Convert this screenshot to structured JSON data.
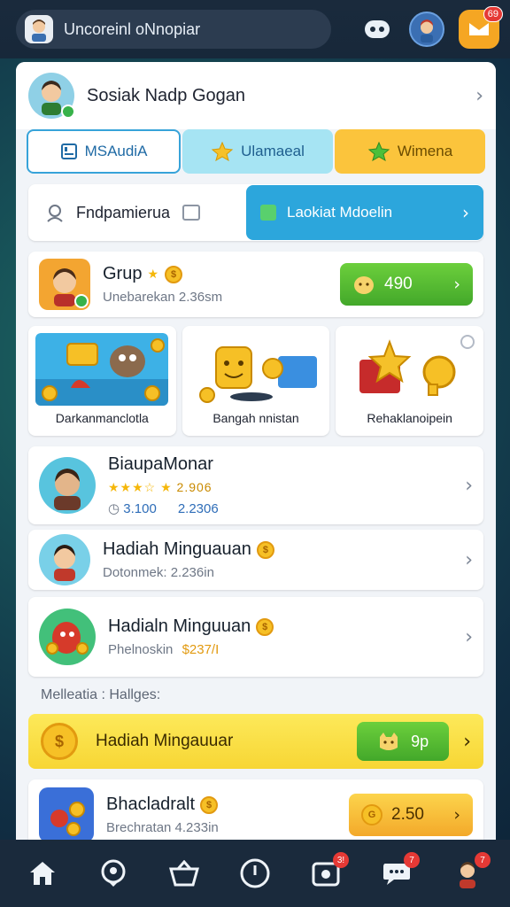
{
  "topbar": {
    "search_text": "Uncoreinl oNnopiar",
    "notif_badge": "69"
  },
  "profile": {
    "name": "Sosiak Nadp Gogan"
  },
  "tabs": [
    {
      "label": "MSAudiA"
    },
    {
      "label": "Ulamaeal"
    },
    {
      "label": "Wimena"
    }
  ],
  "filter": {
    "label": "Fndpamierua",
    "button_label": "Laokiat Mdoelin"
  },
  "group_card": {
    "title": "Grup",
    "subtitle": "Unebarekan 2.36sm",
    "button_value": "490"
  },
  "tiles": [
    {
      "label": "Darkanmanclotla"
    },
    {
      "label": "Bangah nnistan"
    },
    {
      "label": "Rehaklanoipein"
    }
  ],
  "list": [
    {
      "title": "BiaupaMonar",
      "rating": "2.906",
      "meta_a": "3.100",
      "meta_b": "2.2306"
    },
    {
      "title": "Hadiah Minguauan",
      "subtitle": "Dotonmek: 2.236in"
    },
    {
      "title": "Hadialn Minguuan",
      "subtitle_label": "Phelnoskin",
      "subtitle_value": "$237/I"
    }
  ],
  "section_label": "Melleatia : Hallges:",
  "yellow_bar": {
    "label": "Hadiah Mingauuar",
    "button_value": "9p"
  },
  "last_card": {
    "title": "Bhacladralt",
    "subtitle": "Brechratan 4.233in",
    "button_value": "2.50"
  },
  "bottom_nav": {
    "badges": [
      "3!",
      "7",
      "7"
    ]
  },
  "colors": {
    "accent_blue": "#2ca6dc",
    "green_button": "#43a82a",
    "yellow_tab": "#fbc43c",
    "badge_red": "#e53935"
  }
}
